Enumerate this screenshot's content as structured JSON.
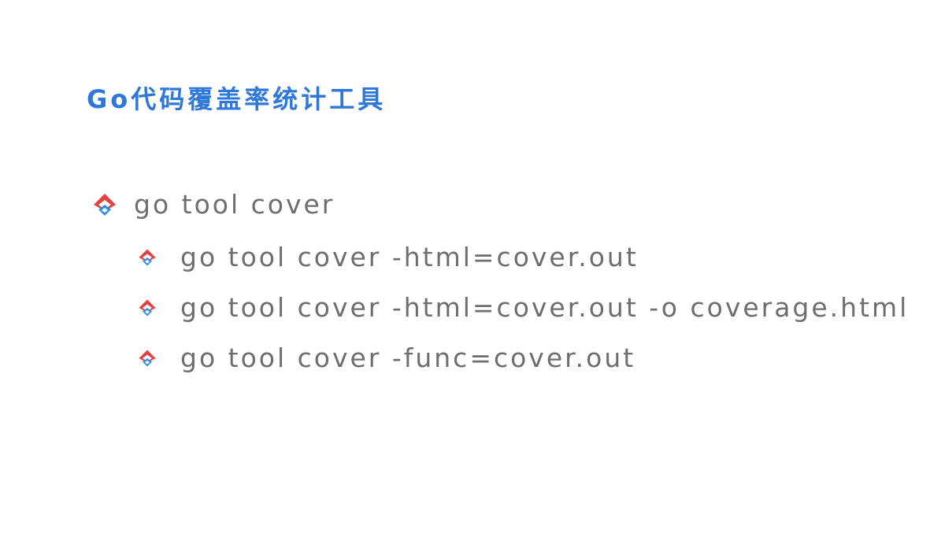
{
  "slide": {
    "title": "Go代码覆盖率统计工具",
    "colors": {
      "title": "#2f77d9",
      "text": "#6e6e6e",
      "bullet_red": "#e3413d",
      "bullet_blue": "#2f8fe0"
    },
    "bullets": [
      {
        "icon": "diamond-bullet-icon",
        "text": "go tool cover",
        "children": [
          {
            "icon": "diamond-bullet-icon",
            "text": "go tool cover -html=cover.out"
          },
          {
            "icon": "diamond-bullet-icon",
            "text": "go tool cover -html=cover.out -o coverage.html"
          },
          {
            "icon": "diamond-bullet-icon",
            "text": "go tool cover -func=cover.out"
          }
        ]
      }
    ]
  }
}
